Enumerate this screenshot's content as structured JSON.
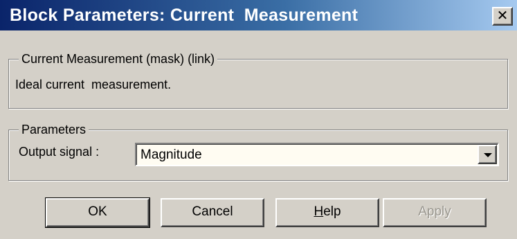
{
  "window": {
    "title": "Block Parameters: Current  Measurement",
    "close_glyph": "✕",
    "title_gradient": [
      "#0a246a",
      "#a6caf0"
    ]
  },
  "mask_group": {
    "legend": "Current Measurement (mask) (link)",
    "description": "Ideal current  measurement."
  },
  "params_group": {
    "legend": "Parameters",
    "output_signal_label": "Output signal :",
    "output_signal_value": "Magnitude",
    "dropdown_icon": "chevron-down-icon"
  },
  "buttons": {
    "ok": "OK",
    "cancel": "Cancel",
    "help_mnemonic": "H",
    "help_rest": "elp",
    "apply": "Apply",
    "apply_enabled": false
  }
}
